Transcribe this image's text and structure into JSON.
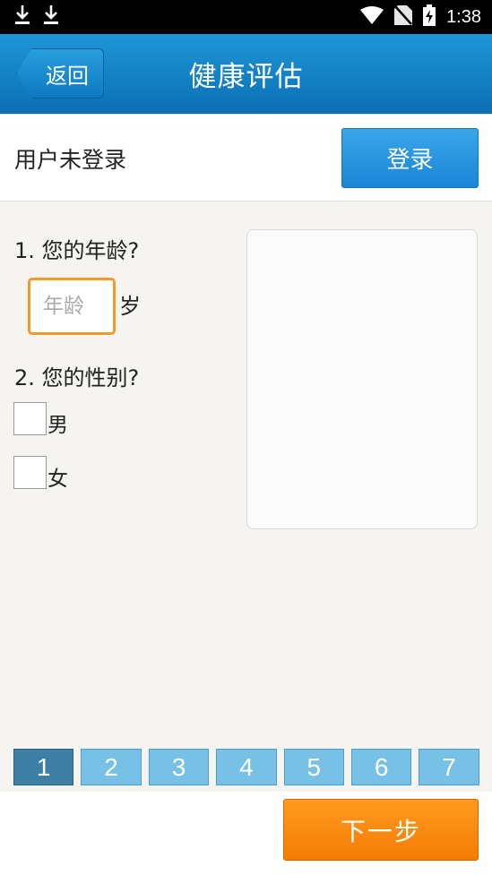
{
  "status_bar": {
    "time": "1:38",
    "left_icons": [
      "download-icon",
      "download-icon"
    ],
    "right_icons": [
      "wifi-icon",
      "no-sim-icon",
      "battery-charging-icon"
    ]
  },
  "header": {
    "back_label": "返回",
    "title": "健康评估"
  },
  "login": {
    "status_text": "用户未登录",
    "button_label": "登录"
  },
  "questions": {
    "q1": {
      "label": "1. 您的年龄?",
      "input_placeholder": "年龄",
      "input_value": "",
      "unit": "岁"
    },
    "q2": {
      "label": "2. 您的性别?",
      "options": [
        {
          "label": "男",
          "checked": false
        },
        {
          "label": "女",
          "checked": false
        }
      ]
    }
  },
  "pagination": {
    "pages": [
      "1",
      "2",
      "3",
      "4",
      "5",
      "6",
      "7"
    ],
    "active": "1"
  },
  "footer": {
    "next_label": "下一步"
  },
  "colors": {
    "header_blue": "#1283c8",
    "login_blue": "#2a96e0",
    "input_border_orange": "#f39a26",
    "next_orange": "#f88a0f",
    "tab_active": "#3e7fa6",
    "tab_inactive": "#77c1e6"
  }
}
